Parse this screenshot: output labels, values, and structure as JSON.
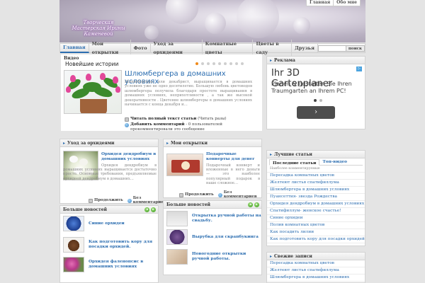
{
  "header": {
    "logo_text": "Творческая Мастерская Ирины Каменевой"
  },
  "toplinks": [
    "Главная",
    "Обо мне"
  ],
  "nav": {
    "items": [
      "Главная",
      "Мои открытки",
      "Фото",
      "Уход за орхидеями",
      "Комнатные цветы",
      "Цветы в саду",
      "Друзья"
    ],
    "search_label": "поиск"
  },
  "featured": {
    "video_label": "Видео",
    "section_title": "Новейшие истории",
    "dots_total": 9,
    "dots_active": 0,
    "title": "Шлюмбергера в домашних условиях",
    "text": "Шлюмбергера, или декабрист, выращивается в домашних условиях уже не одно десятилетие. Большую любовь цветоводов шлюмбергера получила благодаря простоте выращивания в домашних условиях, неприхотливости , а так же высокой декоративности . Цветение шлюмбергеры в домашних условиях начинается с конца декабря и…",
    "read_more_label": "Читать полный текст статьи",
    "read_more_suffix": "(Читать разы)",
    "comment_label": "Добавить комментарий",
    "comment_suffix": "- 0 пользователей прокомментировали это сообщение"
  },
  "ad": {
    "title": "Реклама",
    "headline": "Ihr 3D Gartenplaner",
    "body": "Planen & gestalten Sie Ihren Traumgarten an Ihrem PC!",
    "button": "›"
  },
  "orchid_module": {
    "title": "Уход за орхидеями",
    "article_title": "Орхидея дендробиум в домашних условиях",
    "article_text": "Орхидея дендробиум в домашних условиях выращивается достаточно просто. Основные требования, предъявляемые орхидеей дендробиум в домашних…",
    "continue_label": "Продолжить",
    "no_comments": "Без комментариев",
    "more_news": "Больше новостей",
    "news": [
      "Синие орхидеи",
      "Как подготовить кору для посадки орхидей.",
      "Орхидея фаленопсис в домашних условиях"
    ]
  },
  "cards_module": {
    "title": "Мои открытки",
    "article_title": "Подарочные конверты для денег",
    "article_text": "Подарочный конверт и вложенные в него деньги — это наиболее популярный подарок в наше сложное…",
    "continue_label": "Продолжить",
    "no_comments": "Без комментариев",
    "more_news": "Больше новостей",
    "news": [
      "Открытка ручной работы на свадьбу.",
      "Вырубка для скрапбукинга",
      "Новогодние открытки ручной работы."
    ]
  },
  "best_articles": {
    "title": "Лучшие статьи",
    "tabs": [
      "Последние статьи",
      "Топ-видео"
    ],
    "subheader": "Наиболее комментируемые",
    "items": [
      "Пересадка комнатных цветов",
      "Желтеют листья спатифиллума",
      "Шлюмбергера в домашних условиях",
      "Пуансеттия- звезда Рождества",
      "Орхидея дендробиум в домашних условиях",
      "Спатифиллум- женское счастье!",
      "Синие орхидеи",
      "Полив комнатных цветов",
      "Как посадить лилии",
      "Как подготовить кору для посадки орхидей."
    ]
  },
  "fresh_posts": {
    "title": "Свежие записи",
    "items": [
      "Пересадка комнатных цветов",
      "Желтеют листья спатифиллума",
      "Шлюмбергера в домашних условиях"
    ]
  },
  "colors": {
    "link": "#2b6db0",
    "active_dot": "#f08a1a",
    "nav_bg": "#e2e2e2"
  }
}
